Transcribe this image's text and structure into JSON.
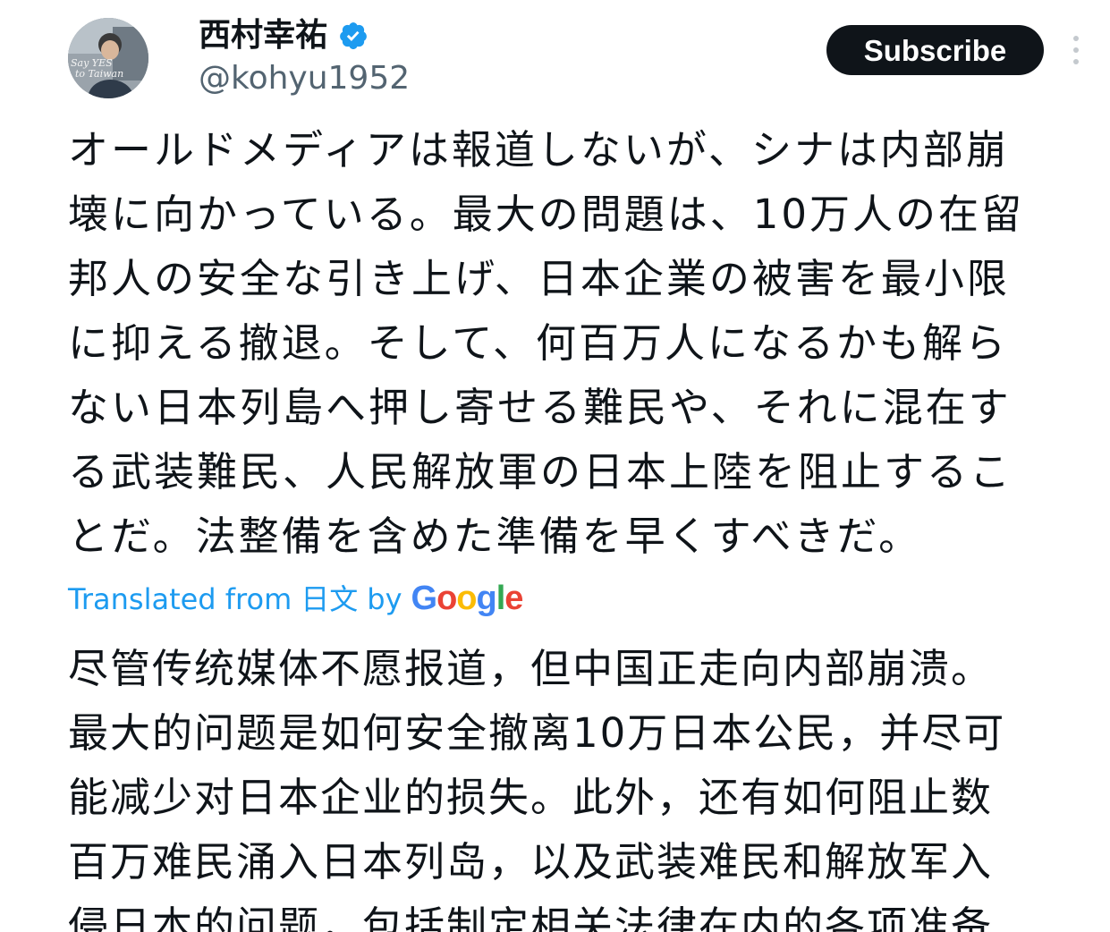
{
  "author": {
    "name": "西村幸祐",
    "handle": "@kohyu1952",
    "verified": true,
    "avatar_caption_line1": "Say YES",
    "avatar_caption_line2": "to Taiwan"
  },
  "actions": {
    "subscribe_label": "Subscribe",
    "more_icon": "more-vertical-icon"
  },
  "tweet": {
    "text": "オールドメディアは報道しないが、シナは内部崩\n壊に向かっている。最大の問題は、10万人の在留\n邦人の安全な引き上げ、日本企業の被害を最小限\nに抑える撤退。そして、何百万人になるかも解ら\nない日本列島へ押し寄せる難民や、それに混在す\nる武装難民、人民解放軍の日本上陸を阻止するこ\nとだ。法整備を含めた準備を早くすべきだ。"
  },
  "translation": {
    "prefix": "Translated from",
    "language": "日文",
    "by": "by",
    "provider_letters": [
      "G",
      "o",
      "o",
      "g",
      "l",
      "e"
    ],
    "text": "尽管传统媒体不愿报道，但中国正走向内部崩溃。\n最大的问题是如何安全撤离10万日本公民，并尽可\n能减少对日本企业的损失。此外，还有如何阻止数\n百万难民涌入日本列岛，以及武装难民和解放军入\n侵日本的问题，包括制定相关法律在内的各项准备"
  },
  "colors": {
    "link": "#1d9bf0",
    "verified": "#1d9bf0",
    "subscribe_bg": "#0f1419",
    "text_primary": "#0f1419",
    "text_secondary": "#536471"
  }
}
